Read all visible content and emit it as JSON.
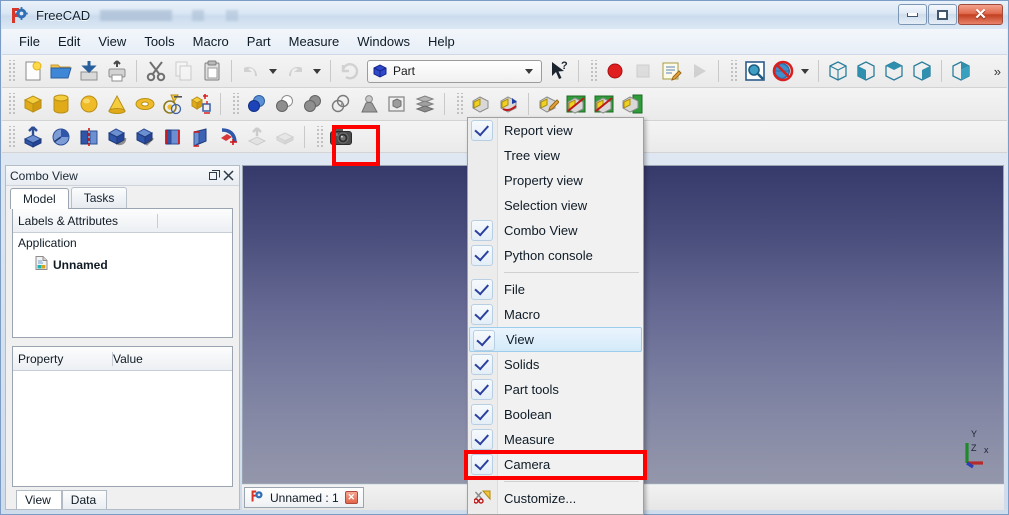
{
  "window": {
    "title": "FreeCAD",
    "app_icon": "freecad-icon",
    "controls": {
      "minimize": "minimize-button",
      "maximize": "maximize-button",
      "close_label": "✕"
    }
  },
  "menubar": {
    "items": [
      {
        "label": "File"
      },
      {
        "label": "Edit"
      },
      {
        "label": "View"
      },
      {
        "label": "Tools"
      },
      {
        "label": "Macro"
      },
      {
        "label": "Part"
      },
      {
        "label": "Measure"
      },
      {
        "label": "Windows"
      },
      {
        "label": "Help"
      }
    ]
  },
  "toolbars": {
    "row1": {
      "file_tools": [
        {
          "name": "new-document-icon",
          "title": "New"
        },
        {
          "name": "open-document-icon",
          "title": "Open"
        },
        {
          "name": "save-document-icon",
          "title": "Save"
        },
        {
          "name": "print-document-icon",
          "title": "Print"
        }
      ],
      "edit_tools": [
        {
          "name": "cut-icon",
          "title": "Cut"
        },
        {
          "name": "copy-icon",
          "title": "Copy"
        },
        {
          "name": "paste-icon",
          "title": "Paste"
        }
      ],
      "history_tools": [
        {
          "name": "undo-icon",
          "title": "Undo"
        },
        {
          "name": "undo-dropdown-icon",
          "title": "Undo history"
        },
        {
          "name": "redo-icon",
          "title": "Redo"
        },
        {
          "name": "redo-dropdown-icon",
          "title": "Redo history"
        }
      ],
      "refresh": {
        "name": "refresh-icon",
        "title": "Refresh"
      },
      "workbench": {
        "selected": "Part",
        "icon": "part-workbench-icon",
        "dropdown_icon": "chevron-down-icon"
      },
      "whats_this": {
        "name": "whats-this-icon",
        "title": "What's This"
      },
      "macro_tools": [
        {
          "name": "macro-record-icon",
          "title": "Macro recording"
        },
        {
          "name": "macro-stop-icon",
          "title": "Stop macro recording"
        },
        {
          "name": "macro-edit-icon",
          "title": "Macros"
        },
        {
          "name": "macro-execute-icon",
          "title": "Execute macro"
        }
      ],
      "view_tools": [
        {
          "name": "fit-all-icon",
          "title": "Fits the whole content on the screen"
        },
        {
          "name": "draw-style-icon",
          "title": "Draw style"
        },
        {
          "name": "draw-style-dropdown-icon",
          "title": "Draw style options"
        },
        {
          "name": "isometric-view-icon",
          "title": "Axonometric"
        },
        {
          "name": "front-view-icon",
          "title": "Front"
        },
        {
          "name": "top-view-icon",
          "title": "Top"
        },
        {
          "name": "right-view-icon",
          "title": "Right"
        },
        {
          "name": "rear-view-icon",
          "title": "Rear"
        }
      ],
      "overflow": {
        "name": "toolbar-overflow-icon",
        "label": "»"
      }
    },
    "row2": {
      "solids": [
        {
          "name": "part-box-icon",
          "title": "Box"
        },
        {
          "name": "part-cylinder-icon",
          "title": "Cylinder"
        },
        {
          "name": "part-sphere-icon",
          "title": "Sphere"
        },
        {
          "name": "part-cone-icon",
          "title": "Cone"
        },
        {
          "name": "part-torus-icon",
          "title": "Torus"
        },
        {
          "name": "part-tube-icon",
          "title": "Tube"
        },
        {
          "name": "part-shapebuilder-icon",
          "title": "Shape builder"
        }
      ],
      "boolean": [
        {
          "name": "boolean-icon",
          "title": "Boolean"
        },
        {
          "name": "boolean-cut-icon",
          "title": "Cut"
        },
        {
          "name": "boolean-union-icon",
          "title": "Union"
        },
        {
          "name": "boolean-intersection-icon",
          "title": "Intersection"
        },
        {
          "name": "part-join-connect-icon",
          "title": "Connect"
        },
        {
          "name": "part-compound-icon",
          "title": "Compound"
        },
        {
          "name": "part-explode-icon",
          "title": "Explode compound"
        }
      ],
      "measure": [
        {
          "name": "measure-linear-icon",
          "title": "Measure linear"
        },
        {
          "name": "measure-angular-icon",
          "title": "Measure angular"
        },
        {
          "name": "measure-refresh-icon",
          "title": "Refresh measures"
        },
        {
          "name": "measure-clear-all-icon",
          "title": "Clear all"
        },
        {
          "name": "measure-toggle-all-icon",
          "title": "Toggle all"
        },
        {
          "name": "measure-toggle-3d-icon",
          "title": "Toggle 3D"
        }
      ]
    },
    "row3": {
      "part_tools": [
        {
          "name": "part-extrude-icon",
          "title": "Extrude"
        },
        {
          "name": "part-revolve-icon",
          "title": "Revolve"
        },
        {
          "name": "part-mirror-icon",
          "title": "Mirroring"
        },
        {
          "name": "part-fillet-icon",
          "title": "Fillet"
        },
        {
          "name": "part-chamfer-icon",
          "title": "Chamfer"
        },
        {
          "name": "part-ruled-surface-icon",
          "title": "Ruled surface"
        },
        {
          "name": "part-loft-icon",
          "title": "Loft"
        },
        {
          "name": "part-sweep-icon",
          "title": "Sweep"
        },
        {
          "name": "part-section-icon",
          "title": "Section"
        },
        {
          "name": "part-cross-sections-icon",
          "title": "Cross-sections"
        }
      ],
      "camera": [
        {
          "name": "camera-icon",
          "title": "Save picture"
        }
      ]
    }
  },
  "combo_view": {
    "title": "Combo View",
    "float_icon": "undock-icon",
    "close_icon": "close-icon",
    "tabs": [
      {
        "label": "Model",
        "selected": true
      },
      {
        "label": "Tasks",
        "selected": false
      }
    ],
    "tree": {
      "headers": [
        "Labels & Attributes",
        ""
      ],
      "rows": [
        {
          "label": "Application",
          "indent": 0,
          "icon": ""
        },
        {
          "label": "Unnamed",
          "indent": 1,
          "icon": "document-icon"
        }
      ]
    },
    "property_editor": {
      "headers": [
        "Property",
        "Value"
      ],
      "rows": [],
      "tabs": [
        {
          "label": "View",
          "selected": true
        },
        {
          "label": "Data",
          "selected": false
        }
      ]
    }
  },
  "viewport": {
    "background_top": "#363a6b",
    "background_bottom": "#9497ab",
    "axis_indicator": {
      "x_label": "x",
      "y_label": "Y",
      "z_label": "Z",
      "x_color": "#b52a2a",
      "y_color": "#1f8a2a",
      "z_color": "#2a3fb5"
    },
    "document_tabs": [
      {
        "label": "Unnamed : 1",
        "icon": "freecad-icon",
        "close_label": "✕",
        "selected": true
      }
    ]
  },
  "view_menu_popup": {
    "groups": [
      {
        "items": [
          {
            "label": "Report view",
            "checked": true,
            "highlighted": false
          },
          {
            "label": "Tree view",
            "checked": false,
            "highlighted": false
          },
          {
            "label": "Property view",
            "checked": false,
            "highlighted": false
          },
          {
            "label": "Selection view",
            "checked": false,
            "highlighted": false
          },
          {
            "label": "Combo View",
            "checked": true,
            "highlighted": false
          },
          {
            "label": "Python console",
            "checked": true,
            "highlighted": false
          }
        ]
      },
      {
        "items": [
          {
            "label": "File",
            "checked": true,
            "highlighted": false
          },
          {
            "label": "Macro",
            "checked": true,
            "highlighted": false
          },
          {
            "label": "View",
            "checked": true,
            "highlighted": true
          },
          {
            "label": "Solids",
            "checked": true,
            "highlighted": false
          },
          {
            "label": "Part tools",
            "checked": true,
            "highlighted": false
          },
          {
            "label": "Boolean",
            "checked": true,
            "highlighted": false
          },
          {
            "label": "Measure",
            "checked": true,
            "highlighted": false
          },
          {
            "label": "Camera",
            "checked": true,
            "highlighted": false,
            "annotated": true
          }
        ]
      },
      {
        "items": [
          {
            "label": "Customize...",
            "checked": false,
            "highlighted": false,
            "icon": "customize-icon"
          }
        ]
      }
    ]
  },
  "annotations": {
    "highlight_color": "#ff0000",
    "boxes": [
      {
        "name": "camera-toolbar-highlight",
        "target": "camera-icon"
      },
      {
        "name": "camera-menu-item-highlight",
        "target": "menu-item-camera"
      }
    ]
  }
}
